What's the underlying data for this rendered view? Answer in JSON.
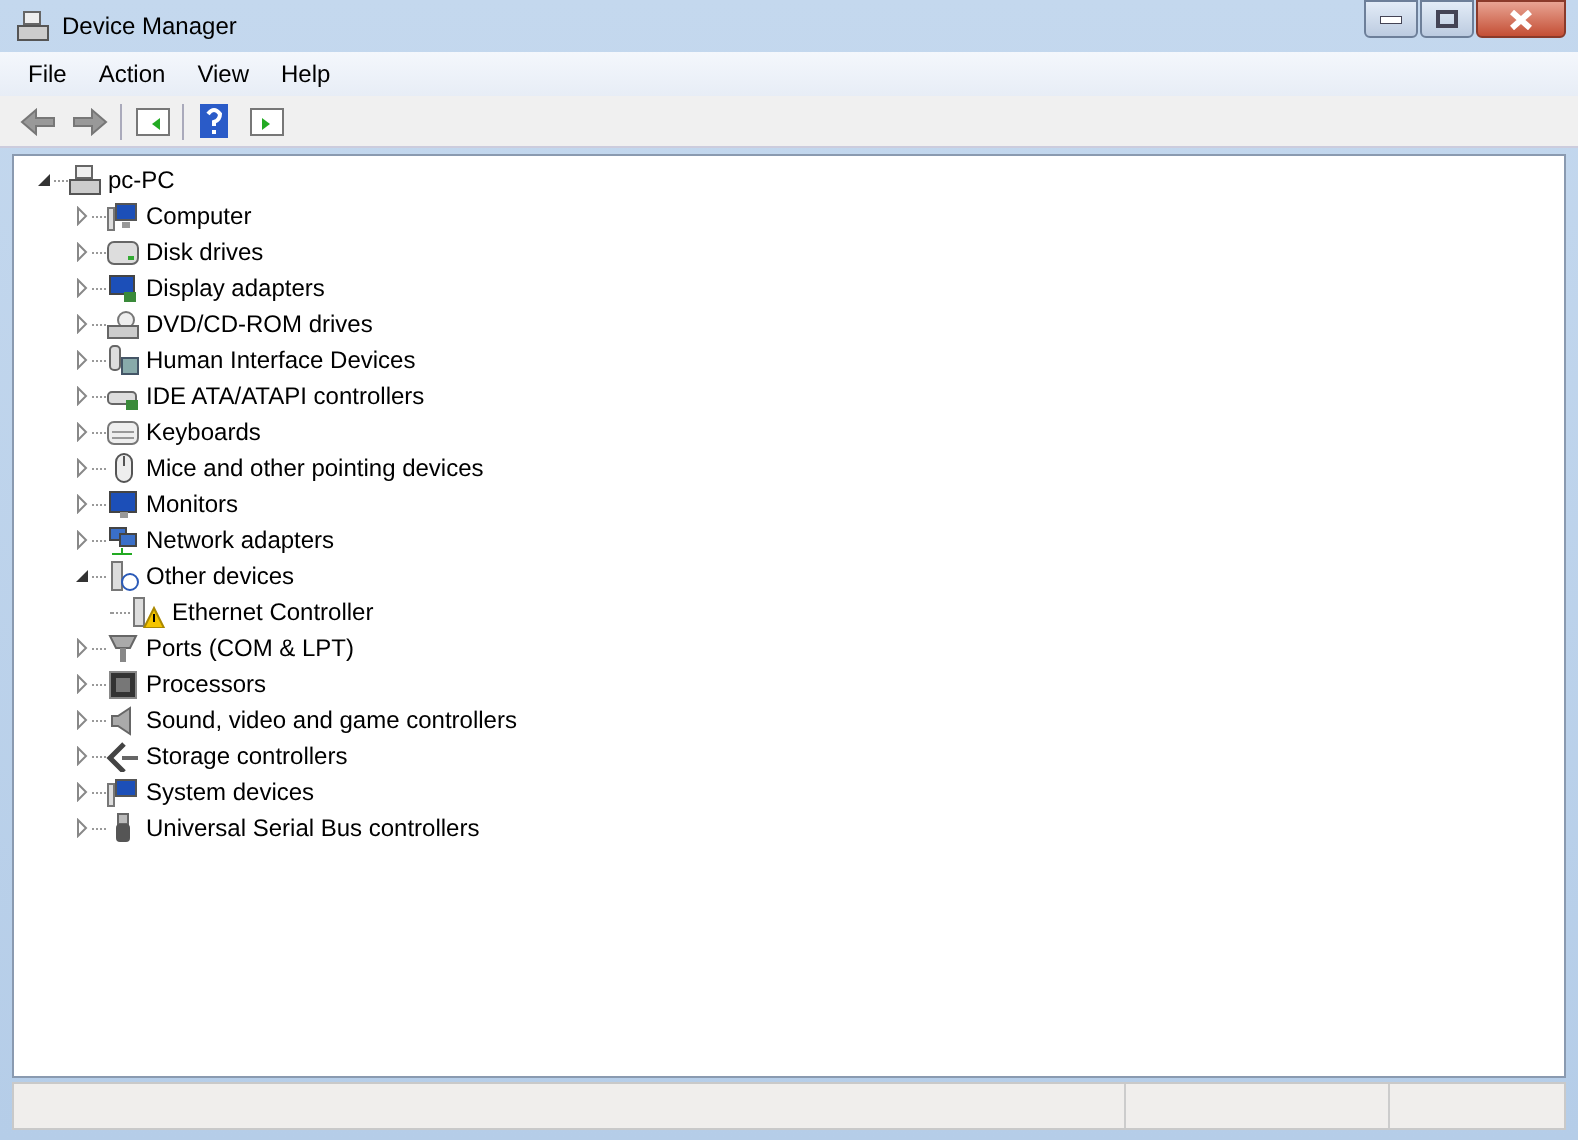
{
  "window": {
    "title": "Device Manager"
  },
  "menu": [
    "File",
    "Action",
    "View",
    "Help"
  ],
  "tree": [
    {
      "label": "pc-PC",
      "expanded": true,
      "children": [
        {
          "label": "Computer",
          "expanded": false
        },
        {
          "label": "Disk drives",
          "expanded": false
        },
        {
          "label": "Display adapters",
          "expanded": false
        },
        {
          "label": "DVD/CD-ROM drives",
          "expanded": false
        },
        {
          "label": "Human Interface Devices",
          "expanded": false
        },
        {
          "label": "IDE ATA/ATAPI controllers",
          "expanded": false
        },
        {
          "label": "Keyboards",
          "expanded": false
        },
        {
          "label": "Mice and other pointing devices",
          "expanded": false
        },
        {
          "label": "Monitors",
          "expanded": false
        },
        {
          "label": "Network adapters",
          "expanded": false
        },
        {
          "label": "Other devices",
          "expanded": true,
          "children": [
            {
              "label": "Ethernet Controller"
            }
          ]
        },
        {
          "label": "Ports (COM & LPT)",
          "expanded": false
        },
        {
          "label": "Processors",
          "expanded": false
        },
        {
          "label": "Sound, video and game controllers",
          "expanded": false
        },
        {
          "label": "Storage controllers",
          "expanded": false
        },
        {
          "label": "System devices",
          "expanded": false
        },
        {
          "label": "Universal Serial Bus controllers",
          "expanded": false
        }
      ]
    }
  ]
}
